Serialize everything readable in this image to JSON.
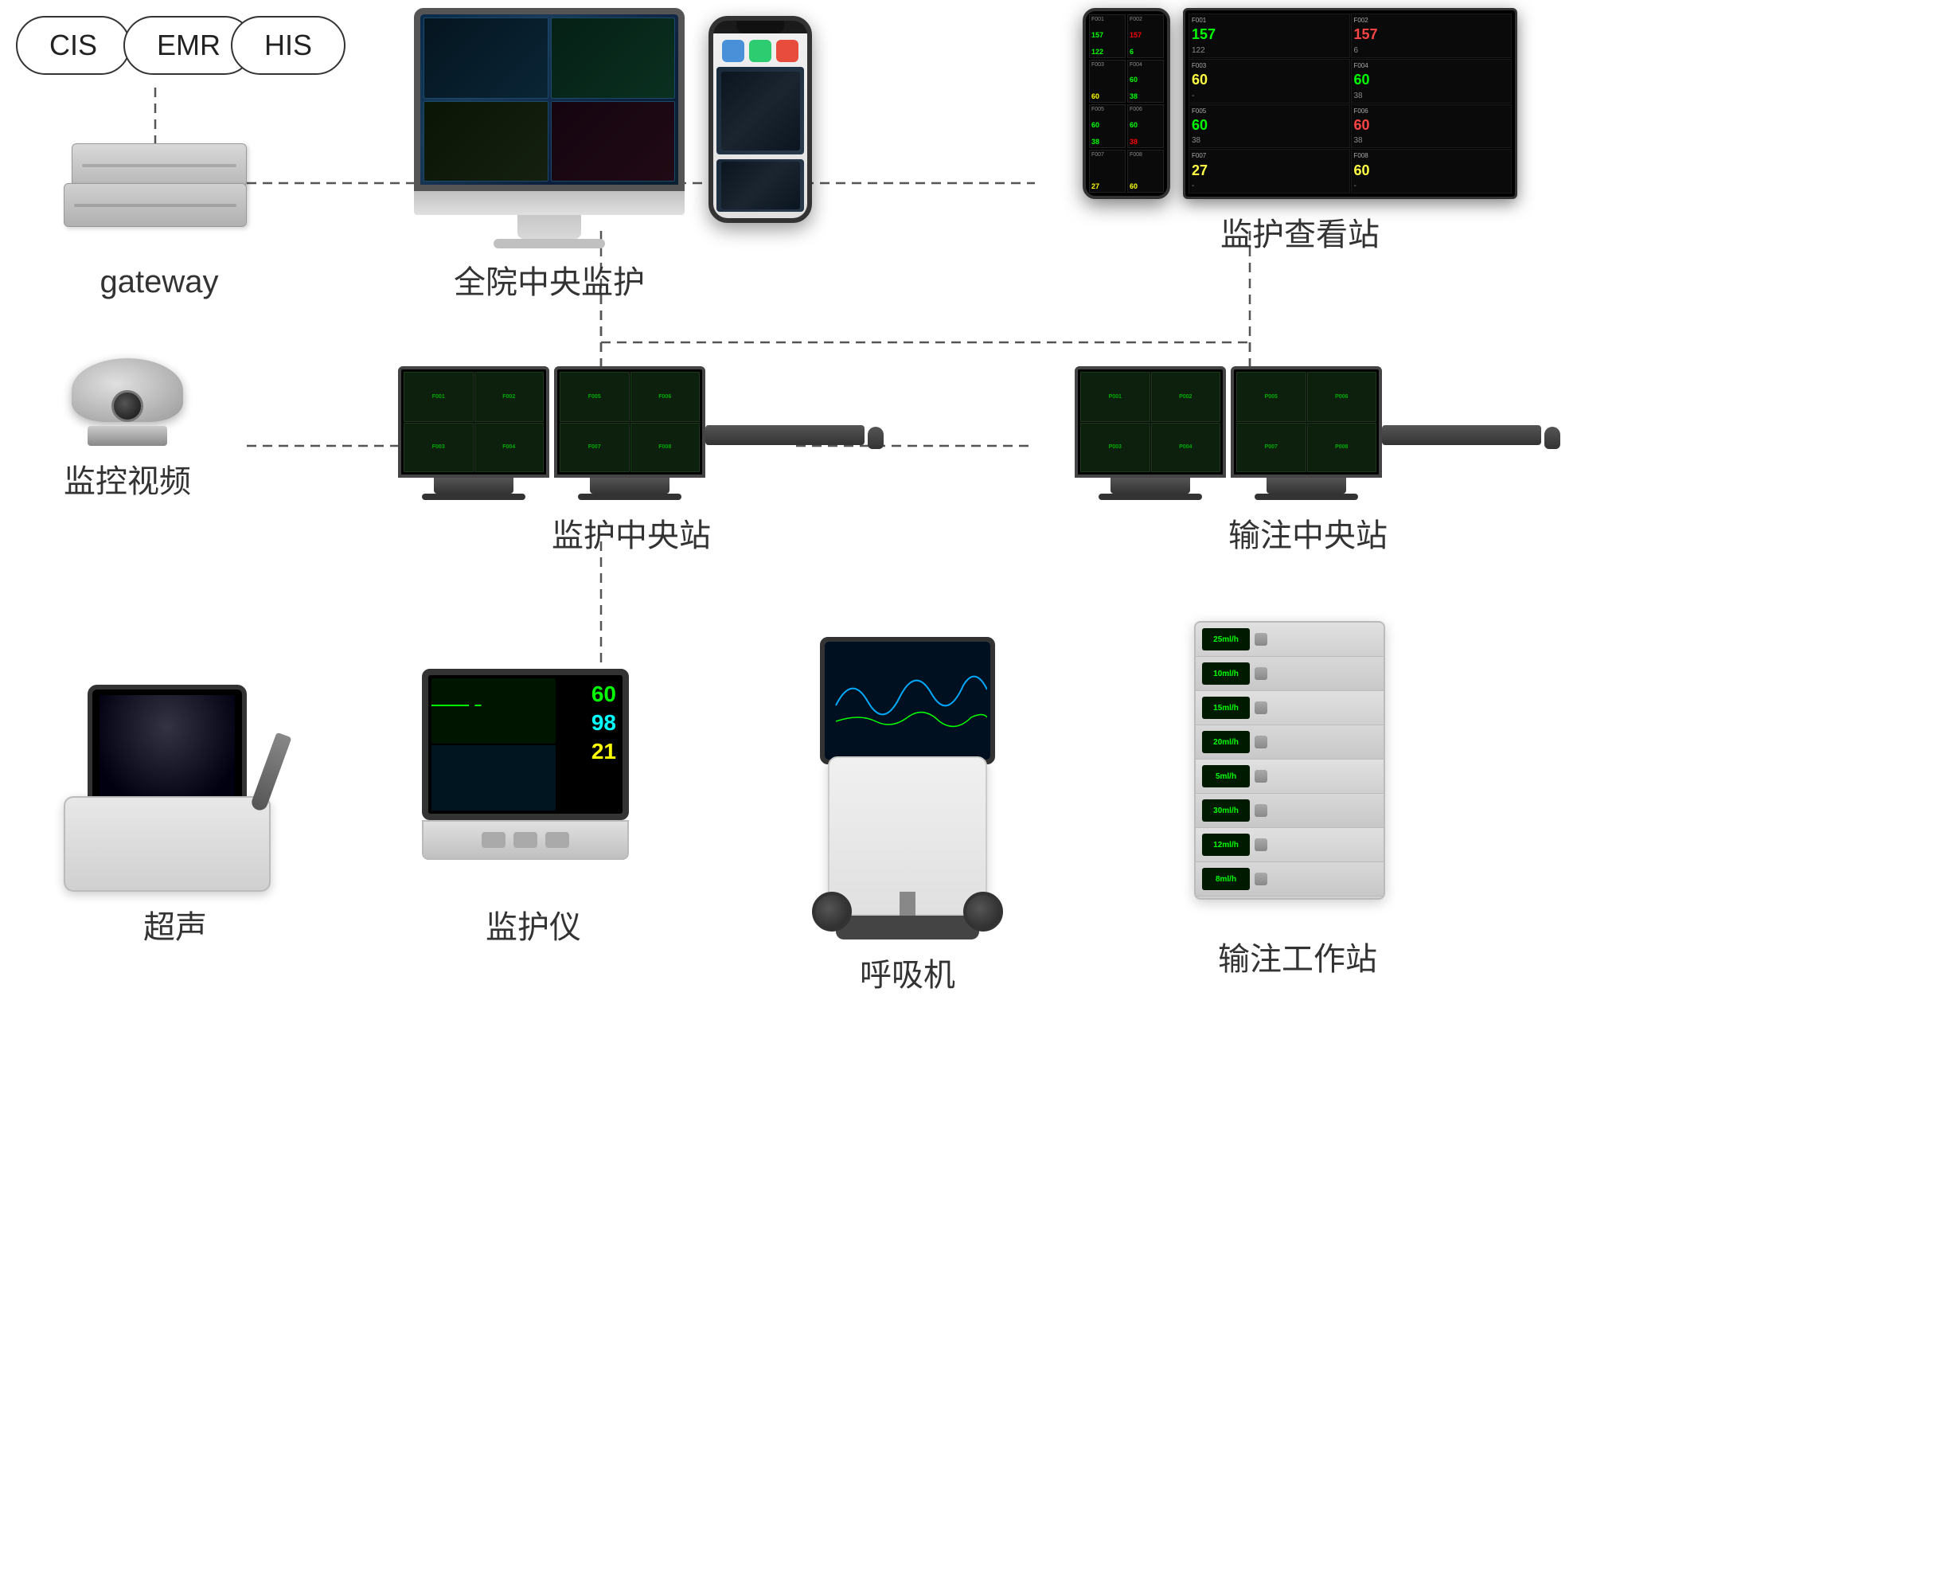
{
  "pills": {
    "cis": "CIS",
    "emr": "EMR",
    "his": "HIS"
  },
  "nodes": {
    "gateway": "gateway",
    "hospital_central": "全院中央监护",
    "viewer_station": "监护查看站",
    "surveillance": "监控视频",
    "monitor_central": "监护中央站",
    "infusion_central": "输注中央站",
    "ultrasound": "超声",
    "patient_monitor": "监护仪",
    "ventilator": "呼吸机",
    "infusion_workstation": "输注工作站"
  },
  "vitals": {
    "val1": "60",
    "val2": "98",
    "val3": "21"
  }
}
